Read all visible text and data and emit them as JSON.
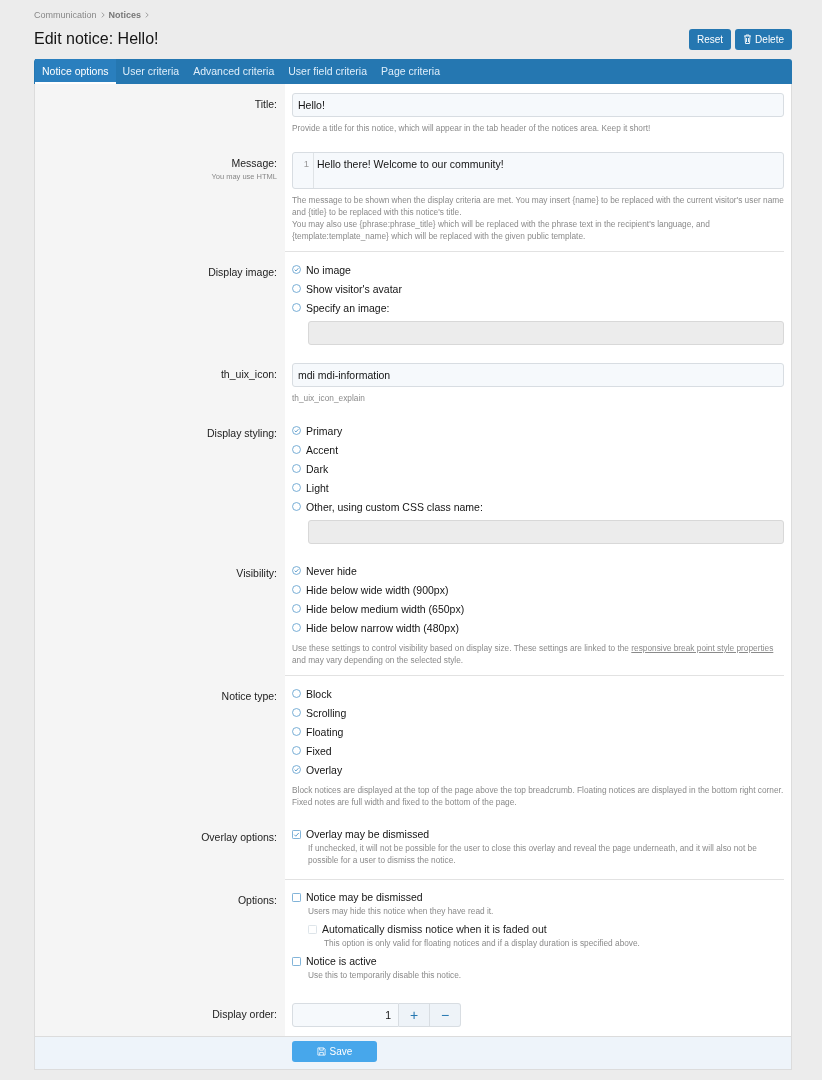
{
  "breadcrumb": [
    "Communication",
    "Notices"
  ],
  "title": "Edit notice: Hello!",
  "header_buttons": [
    {
      "kind": "text",
      "label": "Reset"
    },
    {
      "kind": "delete",
      "label": "Delete"
    }
  ],
  "tabs": [
    {
      "label": "Notice options",
      "selected": true
    },
    {
      "label": "User criteria",
      "selected": false
    },
    {
      "label": "Advanced criteria",
      "selected": false
    },
    {
      "label": "User field criteria",
      "selected": false
    },
    {
      "label": "Page criteria",
      "selected": false
    }
  ],
  "rows": [
    {
      "kind": "text",
      "label": "Title:",
      "value": "Hello!",
      "hints": [
        [
          {
            "kind": "text",
            "text": "Provide a title for this notice, which will appear in the tab header of the notices area. Keep it short!"
          }
        ]
      ],
      "divider_after": false
    },
    {
      "kind": "code",
      "label": "Message:",
      "sublabel": "You may use HTML",
      "line_number": "1",
      "value": "Hello there! Welcome to our community!",
      "hints": [
        [
          {
            "kind": "text",
            "text": "The message to be shown when the display criteria are met. You may insert {name} to be replaced with the current visitor's user name and {title} to be replaced with this notice's title."
          }
        ],
        [
          {
            "kind": "text",
            "text": "You may also use {phrase:phrase_title} which will be replaced with the phrase text in the recipient's language, and {template:template_name} which will be replaced with the given public template."
          }
        ]
      ],
      "divider_after": true
    },
    {
      "kind": "radio",
      "label": "Display image:",
      "options": [
        {
          "label": "No image",
          "selected": true
        },
        {
          "label": "Show visitor's avatar",
          "selected": false
        },
        {
          "label": "Specify an image:",
          "selected": false
        }
      ],
      "trailing_field": true,
      "divider_after": false
    },
    {
      "kind": "text",
      "label": "th_uix_icon:",
      "value": "mdi mdi-information",
      "hints": [
        [
          {
            "kind": "text",
            "text": "th_uix_icon_explain"
          }
        ]
      ],
      "divider_after": false
    },
    {
      "kind": "radio",
      "label": "Display styling:",
      "options": [
        {
          "label": "Primary",
          "selected": true
        },
        {
          "label": "Accent",
          "selected": false
        },
        {
          "label": "Dark",
          "selected": false
        },
        {
          "label": "Light",
          "selected": false
        },
        {
          "label": "Other, using custom CSS class name:",
          "selected": false
        }
      ],
      "trailing_field": true,
      "divider_after": false
    },
    {
      "kind": "radio",
      "label": "Visibility:",
      "options": [
        {
          "label": "Never hide",
          "selected": true
        },
        {
          "label": "Hide below wide width (900px)",
          "selected": false
        },
        {
          "label": "Hide below medium width (650px)",
          "selected": false
        },
        {
          "label": "Hide below narrow width (480px)",
          "selected": false
        }
      ],
      "trailing_field": false,
      "hints": [
        [
          {
            "kind": "text",
            "text": "Use these settings to control visibility based on display size. These settings are linked to the "
          },
          {
            "kind": "link",
            "text": "responsive break point style properties"
          },
          {
            "kind": "text",
            "text": " and may vary depending on the selected style."
          }
        ]
      ],
      "divider_after": true
    },
    {
      "kind": "radio",
      "label": "Notice type:",
      "options": [
        {
          "label": "Block",
          "selected": false
        },
        {
          "label": "Scrolling",
          "selected": false
        },
        {
          "label": "Floating",
          "selected": false
        },
        {
          "label": "Fixed",
          "selected": false
        },
        {
          "label": "Overlay",
          "selected": true
        }
      ],
      "trailing_field": false,
      "hints": [
        [
          {
            "kind": "text",
            "text": "Block notices are displayed at the top of the page above the top breadcrumb. Floating notices are displayed in the bottom right corner. Fixed notes are full width and fixed to the bottom of the page."
          }
        ]
      ],
      "divider_after": false
    },
    {
      "kind": "checkbox",
      "label": "Overlay options:",
      "items": [
        {
          "label": "Overlay may be dismissed",
          "checked": true,
          "disabled": false,
          "hint": "If unchecked, it will not be possible for the user to close this overlay and reveal the page underneath, and it will also not be possible for a user to dismiss the notice."
        }
      ],
      "divider_after": true
    },
    {
      "kind": "checkbox",
      "label": "Options:",
      "items": [
        {
          "label": "Notice may be dismissed",
          "checked": false,
          "disabled": false,
          "hint": "Users may hide this notice when they have read it.",
          "children": [
            {
              "label": "Automatically dismiss notice when it is faded out",
              "checked": false,
              "disabled": true,
              "hint": "This option is only valid for floating notices and if a display duration is specified above."
            }
          ]
        },
        {
          "label": "Notice is active",
          "checked": false,
          "disabled": false,
          "hint": "Use this to temporarily disable this notice."
        }
      ],
      "divider_after": false
    },
    {
      "kind": "number",
      "label": "Display order:",
      "value": "1",
      "plus": "+",
      "minus": "−",
      "divider_after": false
    }
  ],
  "footer": {
    "save": "Save"
  }
}
